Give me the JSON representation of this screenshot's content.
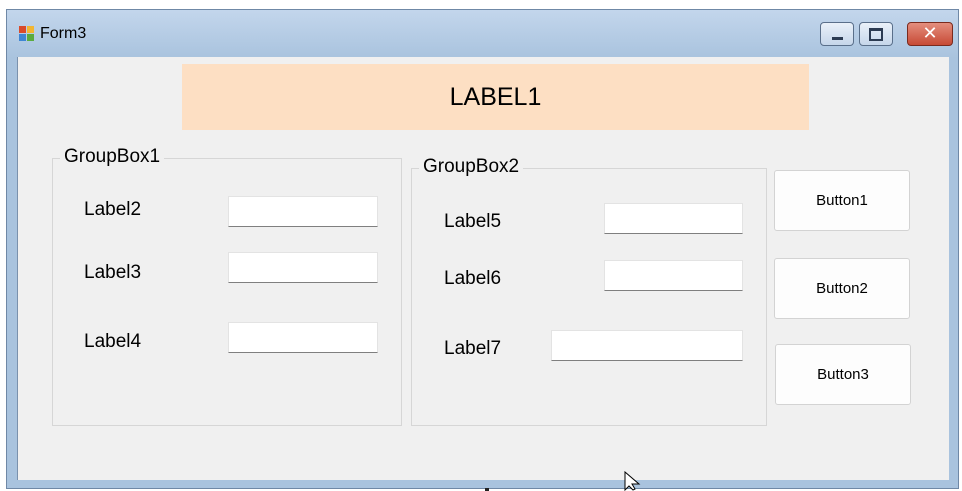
{
  "window": {
    "title": "Form3",
    "controls": {
      "minimize": "minimize-icon",
      "maximize": "maximize-icon",
      "close": "✕"
    }
  },
  "banner": {
    "text": "LABEL1",
    "color": "#fddfc3"
  },
  "group1": {
    "title": "GroupBox1",
    "rows": [
      {
        "label": "Label2",
        "value": ""
      },
      {
        "label": "Label3",
        "value": ""
      },
      {
        "label": "Label4",
        "value": ""
      }
    ]
  },
  "group2": {
    "title": "GroupBox2",
    "rows": [
      {
        "label": "Label5",
        "value": ""
      },
      {
        "label": "Label6",
        "value": ""
      },
      {
        "label": "Label7",
        "value": ""
      }
    ]
  },
  "buttons": [
    "Button1",
    "Button2",
    "Button3"
  ]
}
